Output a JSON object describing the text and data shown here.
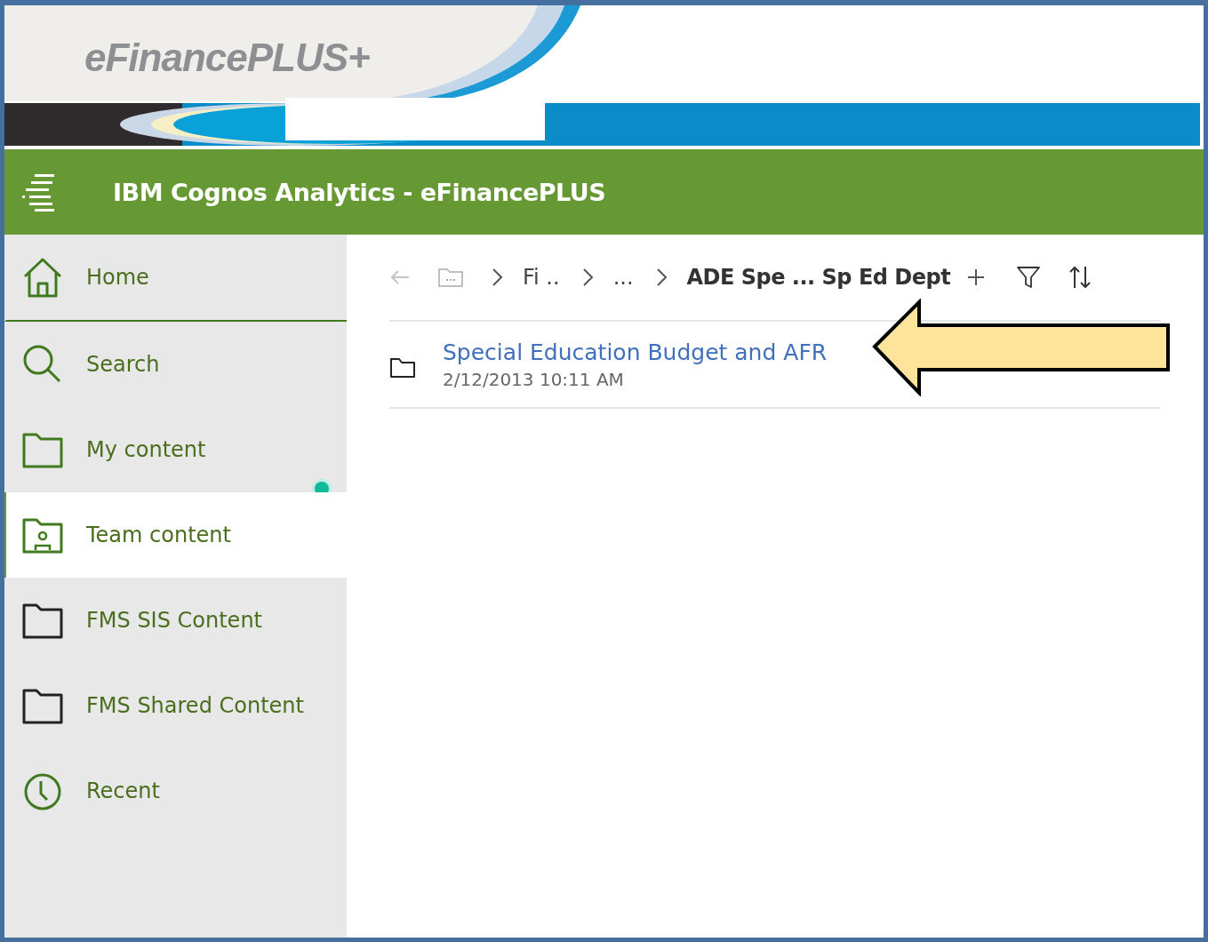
{
  "banner": {
    "logo": "eFinancePLUS+"
  },
  "header": {
    "title": "IBM Cognos Analytics - eFinancePLUS"
  },
  "sidebar": {
    "items": [
      {
        "label": "Home",
        "kind": "home",
        "selected": false,
        "badge": false
      },
      {
        "label": "Search",
        "kind": "search",
        "selected": false,
        "badge": false
      },
      {
        "label": "My content",
        "kind": "folder",
        "selected": false,
        "badge": false
      },
      {
        "label": "Team content",
        "kind": "team",
        "selected": true,
        "badge": true
      },
      {
        "label": "FMS SIS Content",
        "kind": "plain-folder",
        "selected": false,
        "badge": false
      },
      {
        "label": "FMS Shared Content",
        "kind": "plain-folder",
        "selected": false,
        "badge": false
      },
      {
        "label": "Recent",
        "kind": "clock",
        "selected": false,
        "badge": false
      }
    ]
  },
  "breadcrumb": {
    "back_disabled": true,
    "crumbs": [
      "Fi ..",
      "...",
      "ADE Spe ... Sp Ed Dept"
    ]
  },
  "items": [
    {
      "title": "Special Education Budget and AFR",
      "date": "2/12/2013 10:11 AM"
    }
  ],
  "callout": {
    "kind": "arrow"
  }
}
